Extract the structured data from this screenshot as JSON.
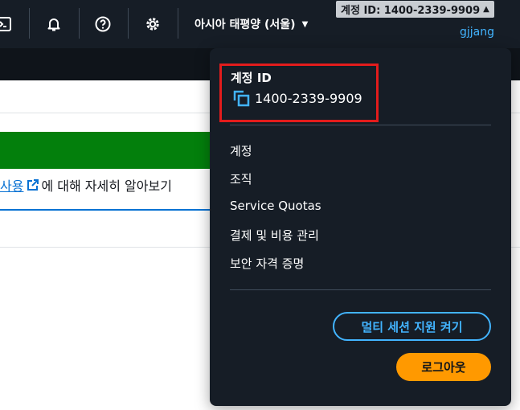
{
  "topbar": {
    "region": "아시아 태평양 (서울)",
    "account_tag": "계정 ID: 1400-2339-9909",
    "username": "gjjang",
    "icons": [
      "cloudshell-icon",
      "bell-icon",
      "help-icon",
      "gear-icon"
    ]
  },
  "content": {
    "learn_link": "사용",
    "learn_text": "에 대해 자세히 알아보기",
    "flash_color": "#037f0c"
  },
  "dropdown": {
    "account_label": "계정 ID",
    "account_id": "1400-2339-9909",
    "menu": [
      "계정",
      "조직",
      "Service Quotas",
      "결제 및 비용 관리",
      "보안 자격 증명"
    ],
    "multi_session_button": "멀티 세션 지원 켜기",
    "logout_button": "로그아웃"
  },
  "colors": {
    "nav_bg": "#161d26",
    "accent_blue": "#42b4ff",
    "primary_orange": "#ff9900",
    "highlight_red": "#e31c1c"
  }
}
